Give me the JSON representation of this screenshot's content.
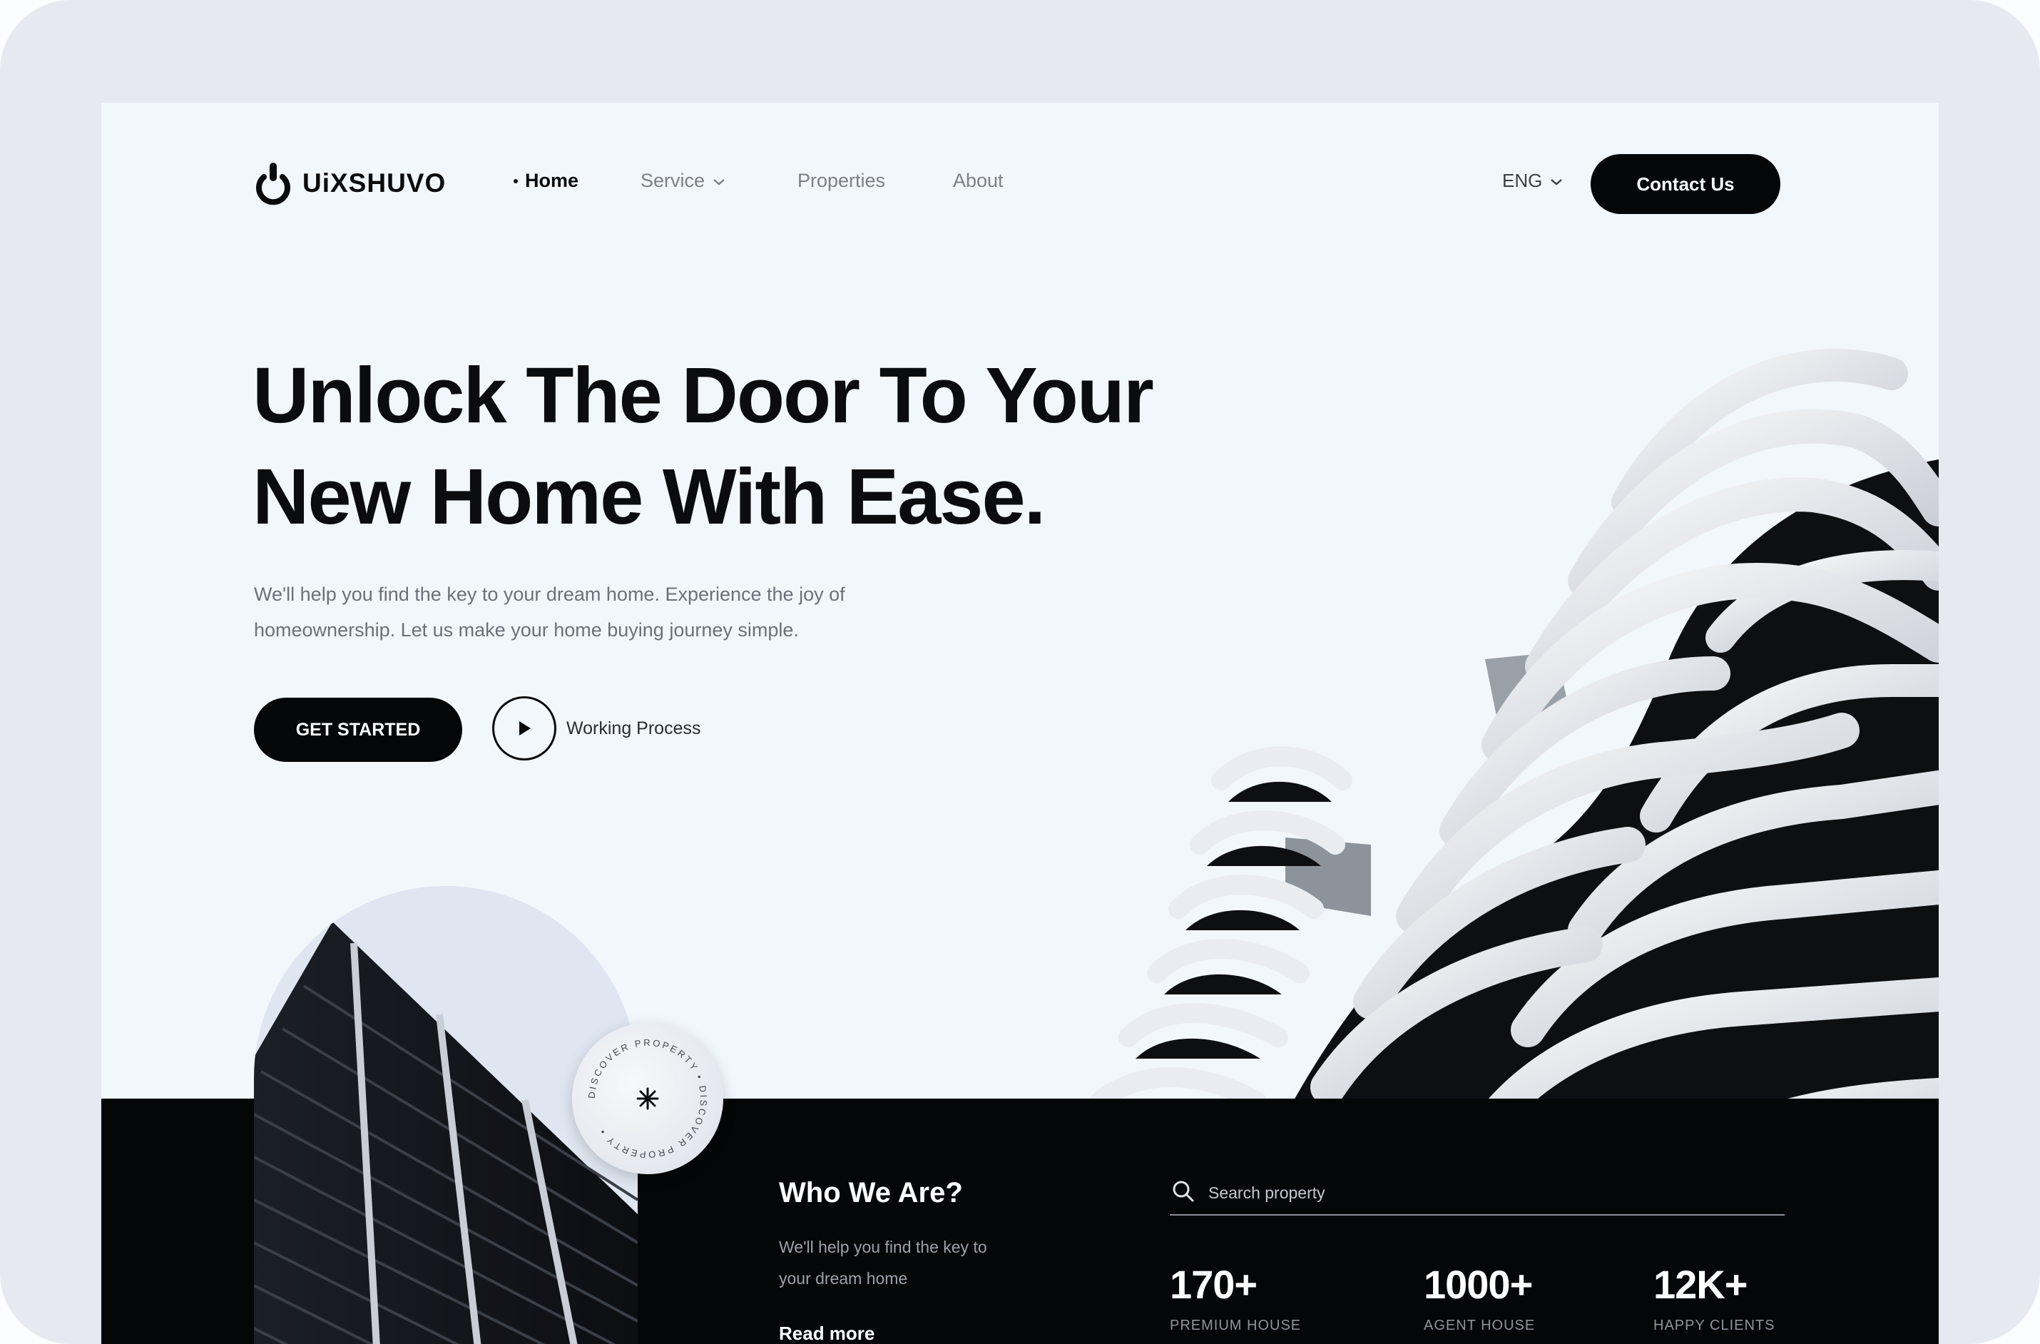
{
  "brand": {
    "name": "UiXSHUVO"
  },
  "nav": {
    "items": [
      {
        "label": "Home",
        "active": true
      },
      {
        "label": "Service",
        "has_dropdown": true
      },
      {
        "label": "Properties"
      },
      {
        "label": "About"
      }
    ],
    "language": "ENG",
    "contact_label": "Contact Us"
  },
  "hero": {
    "title_line1": "Unlock The Door To Your",
    "title_line2": "New Home With Ease.",
    "subtitle_line1": "We'll help you find the key to your dream home. Experience the joy of",
    "subtitle_line2": "homeownership. Let us make your home buying journey simple.",
    "cta_label": "GET STARTED",
    "video_label": "Working Process"
  },
  "badge": {
    "ring_text": "DISCOVER PROPERTY • DISCOVER PROPERTY • "
  },
  "about": {
    "title": "Who We Are?",
    "text": "We'll help you find the key to your dream home",
    "read_more": "Read more"
  },
  "search": {
    "placeholder": "Search property"
  },
  "stats": [
    {
      "value": "170+",
      "label": "PREMIUM HOUSE"
    },
    {
      "value": "1000+",
      "label": "AGENT HOUSE"
    },
    {
      "value": "12K+",
      "label": "HAPPY CLIENTS"
    }
  ],
  "colors": {
    "accent": "#050608",
    "page_bg": "#f2f7fc",
    "frame": "#e6e9ef"
  },
  "icons": [
    "power-logo-icon",
    "chevron-down-icon",
    "play-icon",
    "search-icon",
    "asterisk-icon"
  ]
}
